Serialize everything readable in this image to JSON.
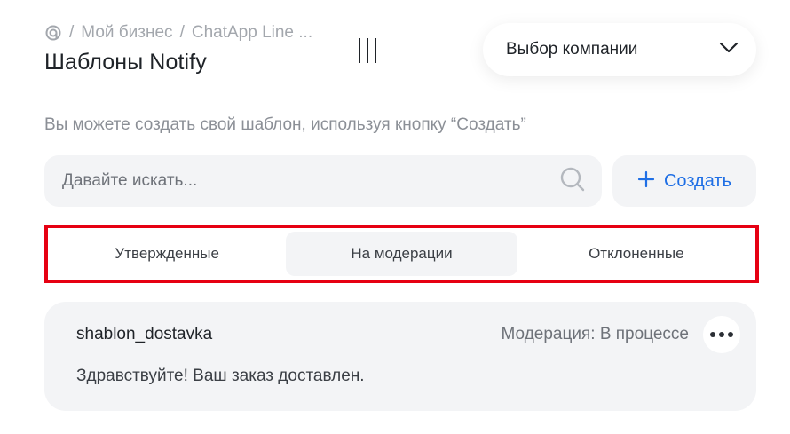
{
  "breadcrumb": {
    "items": [
      "Мой бизнес",
      "ChatApp Line ..."
    ],
    "separator": "/"
  },
  "page_title": "Шаблоны Notify",
  "company_select": {
    "label": "Выбор компании"
  },
  "hint": "Вы можете создать свой шаблон, используя кнопку “Создать”",
  "search": {
    "placeholder": "Давайте искать..."
  },
  "create_button": {
    "label": "Создать"
  },
  "tabs": [
    {
      "label": "Утвержденные",
      "active": false
    },
    {
      "label": "На модерации",
      "active": true
    },
    {
      "label": "Отклоненные",
      "active": false
    }
  ],
  "templates": [
    {
      "name": "shablon_dostavka",
      "status": "Модерация: В процессе",
      "text": "Здравствуйте! Ваш заказ доставлен."
    }
  ],
  "colors": {
    "accent": "#1f6fe5",
    "highlight_frame": "#e60012",
    "surface": "#f3f4f6"
  },
  "icons": {
    "home": "home-icon",
    "chevron": "chevron-down-icon",
    "search": "search-icon",
    "plus": "plus-icon",
    "more": "more-dots-icon",
    "drag": "drag-handle-icon"
  }
}
